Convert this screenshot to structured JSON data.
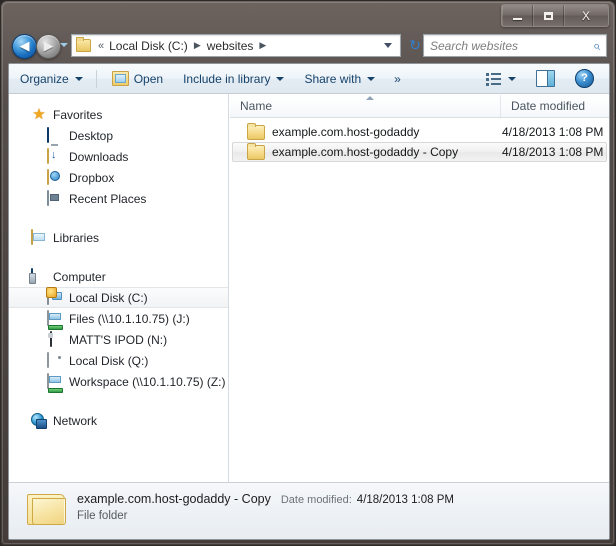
{
  "window": {
    "controls": {
      "minimize_label": "Minimize",
      "maximize_label": "Maximize",
      "close_label": "X"
    }
  },
  "addressbar": {
    "back_label": "◀",
    "forward_label": "▶",
    "overflow_chevrons": "«",
    "crumbs": [
      "Local Disk (C:)",
      "websites"
    ],
    "separator": "▶",
    "refresh_icon": "↻"
  },
  "search": {
    "placeholder": "Search websites",
    "icon": "⌕"
  },
  "toolbar": {
    "organize_label": "Organize",
    "open_label": "Open",
    "include_label": "Include in library",
    "share_label": "Share with",
    "overflow_label": "»",
    "views_label": "Change your view",
    "preview_label": "Show the preview pane",
    "help_label": "?"
  },
  "navpane": {
    "groups": [
      {
        "header": {
          "label": "Favorites",
          "icon": "star-icon"
        },
        "items": [
          {
            "label": "Desktop",
            "icon": "desktop-icon"
          },
          {
            "label": "Downloads",
            "icon": "downloads-icon"
          },
          {
            "label": "Dropbox",
            "icon": "dropbox-icon"
          },
          {
            "label": "Recent Places",
            "icon": "recent-places-icon"
          }
        ]
      },
      {
        "header": {
          "label": "Libraries",
          "icon": "libraries-icon"
        },
        "items": []
      },
      {
        "header": {
          "label": "Computer",
          "icon": "computer-icon"
        },
        "items": [
          {
            "label": "Local Disk (C:)",
            "icon": "local-disk-c-icon",
            "selected": true
          },
          {
            "label": "Files (\\\\10.1.10.75) (J:)",
            "icon": "network-drive-icon"
          },
          {
            "label": "MATT'S IPOD (N:)",
            "icon": "ipod-icon"
          },
          {
            "label": "Local Disk (Q:)",
            "icon": "local-disk-q-icon"
          },
          {
            "label": "Workspace (\\\\10.1.10.75) (Z:)",
            "icon": "network-drive-icon"
          }
        ]
      },
      {
        "header": {
          "label": "Network",
          "icon": "network-icon"
        },
        "items": []
      }
    ]
  },
  "filelist": {
    "columns": [
      {
        "key": "name",
        "label": "Name",
        "sorted": "asc"
      },
      {
        "key": "date",
        "label": "Date modified"
      }
    ],
    "rows": [
      {
        "name": "example.com.host-godaddy",
        "date": "4/18/2013 1:08 PM",
        "selected": false
      },
      {
        "name": "example.com.host-godaddy - Copy",
        "date": "4/18/2013 1:08 PM",
        "selected": true
      }
    ]
  },
  "scrollbar": {
    "left_arrow": "◀",
    "right_arrow": "▶",
    "grip": "❙❙❙"
  },
  "details": {
    "filename": "example.com.host-godaddy - Copy",
    "date_label": "Date modified:",
    "date_value": "4/18/2013 1:08 PM",
    "type": "File folder"
  },
  "colors": {
    "frame": "#4a433f",
    "toolbar_text": "#16436b",
    "client_bg": "#ffffff",
    "folder_yellow": "#eac965",
    "selection_bg": "#f0f0f0"
  }
}
